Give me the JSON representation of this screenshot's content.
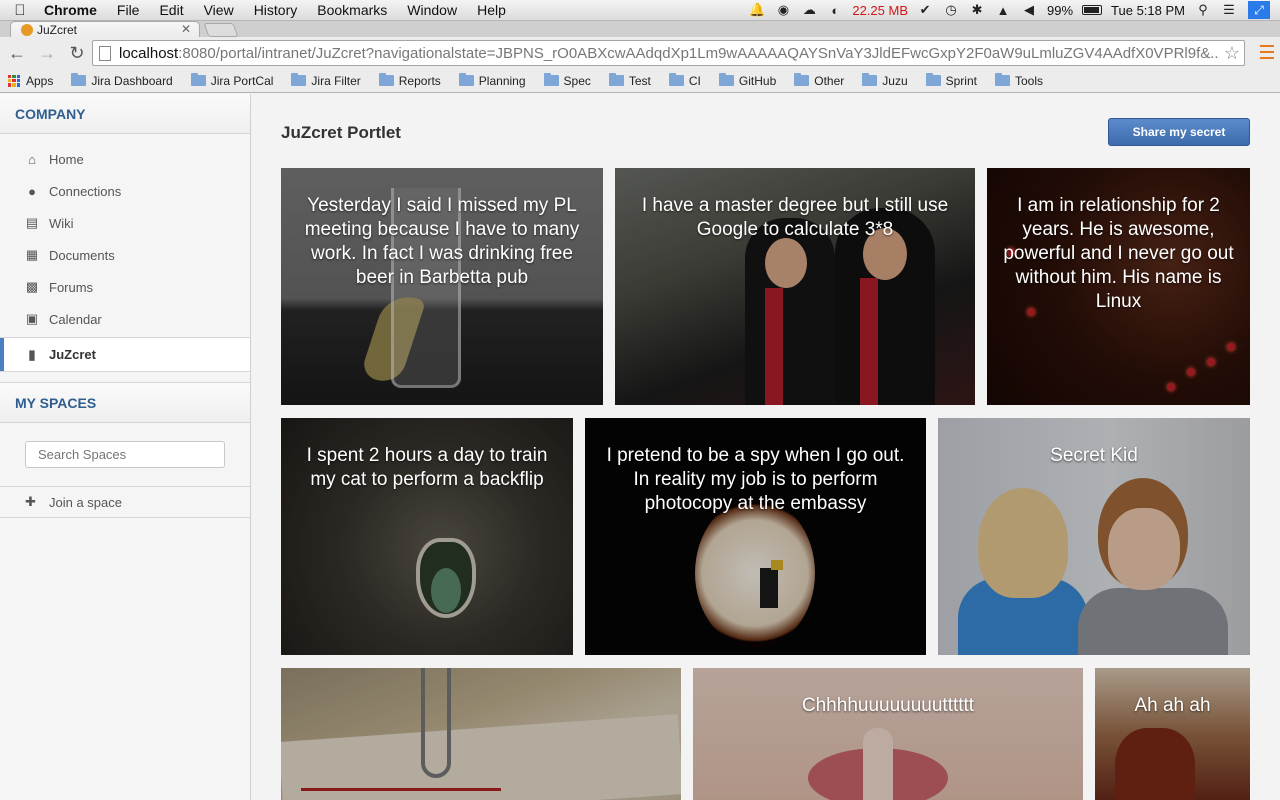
{
  "menubar": {
    "app": "Chrome",
    "items": [
      "File",
      "Edit",
      "View",
      "History",
      "Bookmarks",
      "Window",
      "Help"
    ],
    "memory": "22.25 MB",
    "battery": "99%",
    "clock": "Tue 5:18 PM"
  },
  "browser": {
    "tab_title": "JuZcret",
    "url_host": "localhost",
    "url_rest": ":8080/portal/intranet/JuZcret?navigationalstate=JBPNS_rO0ABXcwAAdqdXp1Lm9wAAAAAQAYSnVaY3JldEFwcGxpY2F0aW9uLmluZGV4AAdfX0VPRl9f&...",
    "bookmarks": [
      "Apps",
      "Jira Dashboard",
      "Jira PortCal",
      "Jira Filter",
      "Reports",
      "Planning",
      "Spec",
      "Test",
      "CI",
      "GitHub",
      "Other",
      "Juzu",
      "Sprint",
      "Tools"
    ]
  },
  "sidebar": {
    "company_title": "COMPANY",
    "nav": [
      {
        "label": "Home",
        "icon": "home-icon"
      },
      {
        "label": "Connections",
        "icon": "person-icon"
      },
      {
        "label": "Wiki",
        "icon": "book-icon"
      },
      {
        "label": "Documents",
        "icon": "folder-icon"
      },
      {
        "label": "Forums",
        "icon": "chat-icon"
      },
      {
        "label": "Calendar",
        "icon": "calendar-icon"
      },
      {
        "label": "JuZcret",
        "icon": "document-icon",
        "active": true
      }
    ],
    "spaces_title": "MY SPACES",
    "search_placeholder": "Search Spaces",
    "join_label": "Join a space"
  },
  "main": {
    "title": "JuZcret Portlet",
    "share_button": "Share my secret",
    "secrets": [
      "Yesterday I said I missed my PL meeting because I have to many work. In fact I was drinking free beer in Barbetta pub",
      "I have a master degree but I still use Google to calculate 3*8",
      "I am in relationship for 2 years. He is awesome, powerful and I never go out without him. His name is Linux",
      "I spent 2 hours a day to train my cat to perform a backflip",
      "I pretend to be a spy when I go out. In reality my job is to perform photocopy at the embassy",
      "Secret Kid",
      "",
      "Chhhhuuuuuuuutttttt",
      "Ah ah ah"
    ]
  }
}
